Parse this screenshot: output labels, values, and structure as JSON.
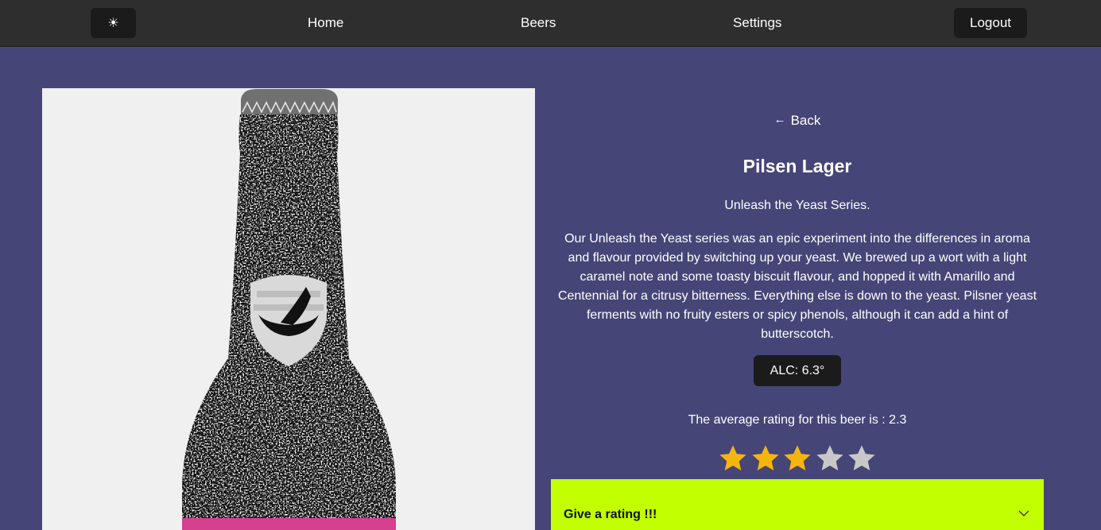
{
  "nav": {
    "theme_icon": "☀",
    "links": [
      "Home",
      "Beers",
      "Settings"
    ],
    "logout_label": "Logout"
  },
  "beer": {
    "back_label": "Back",
    "name": "Pilsen Lager",
    "tagline": "Unleash the Yeast Series.",
    "description": "Our Unleash the Yeast series was an epic experiment into the differences in aroma and flavour provided by switching up your yeast. We brewed up a wort with a light caramel note and some toasty biscuit flavour, and hopped it with Amarillo and Centennial for a citrusy bitterness. Everything else is down to the yeast. Pilsner yeast ferments with no fruity esters or spicy phenols, although it can add a hint of butterscotch.",
    "abv_label": "ALC: 6.3°",
    "average_rating_text": "The average rating for this beer is : 2.3",
    "stars_filled": 3,
    "stars_total": 5,
    "rate_label": "Give a rating !!!"
  },
  "icons": {
    "back": "arrow-left-icon",
    "star": "star-icon",
    "expand": "chevron-down-icon",
    "theme": "sun-icon"
  },
  "colors": {
    "background": "#464577",
    "navbar": "#2e2e2e",
    "button_dark": "#1b1b1b",
    "star_filled": "#f5b50f",
    "star_empty": "#c8c8c8",
    "rate_panel": "#c2ff00"
  }
}
